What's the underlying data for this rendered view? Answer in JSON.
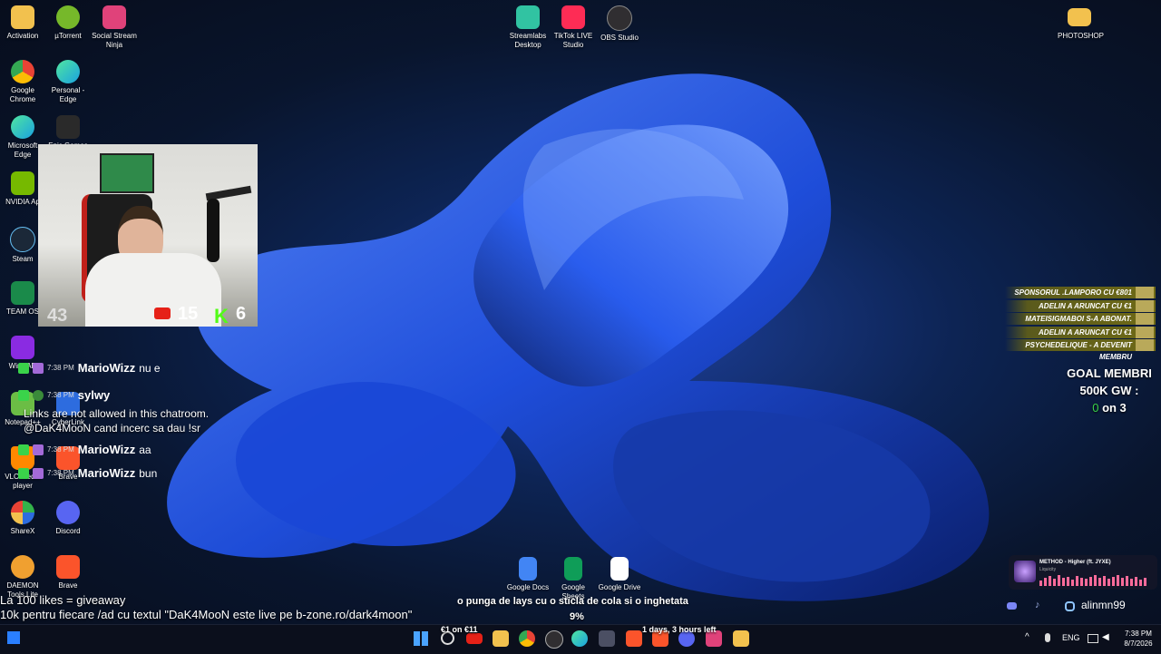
{
  "colors": {
    "accent": "#1f4fe0",
    "chat_badge_green": "#3ad34a",
    "youtube_red": "#e62117",
    "kick_green": "#53fc18",
    "event_gold": "#6f6a16"
  },
  "desktop_icons": [
    {
      "name": "Activation",
      "icon": "folder-icon",
      "color": "#f2c14e"
    },
    {
      "name": "µTorrent",
      "icon": "utorrent-icon",
      "color": "#76b82a"
    },
    {
      "name": "Social Stream Ninja",
      "icon": "social-stream-ninja-icon",
      "color": "#e0427a"
    },
    {
      "name": "Google Chrome",
      "icon": "chrome-icon",
      "color": "#e94335"
    },
    {
      "name": "Personal - Edge",
      "icon": "edge-icon",
      "color": "#1aa2e0"
    },
    {
      "name": "Microsoft Edge",
      "icon": "edge-icon",
      "color": "#1aa2e0"
    },
    {
      "name": "Epic Games",
      "icon": "epic-games-icon",
      "color": "#2a2a2a"
    },
    {
      "name": "NVIDIA Ap",
      "icon": "nvidia-icon",
      "color": "#76b900"
    },
    {
      "name": "Steam",
      "icon": "steam-icon",
      "color": "#1b2838"
    },
    {
      "name": "TEAM OS",
      "icon": "team-os-icon",
      "color": "#1a8a4a"
    },
    {
      "name": "WinRAR",
      "icon": "winrar-icon",
      "color": "#8a2be2"
    },
    {
      "name": "Notepad++",
      "icon": "notepad-plus-plus-icon",
      "color": "#6bbd45"
    },
    {
      "name": "CyberLink",
      "icon": "cyberlink-icon",
      "color": "#2d6cdf"
    },
    {
      "name": "VLC media player",
      "icon": "vlc-icon",
      "color": "#ff8800"
    },
    {
      "name": "Brave",
      "icon": "brave-icon",
      "color": "#fb542b"
    },
    {
      "name": "ShareX",
      "icon": "sharex-icon",
      "color": "#33b34a"
    },
    {
      "name": "Discord",
      "icon": "discord-icon",
      "color": "#5865f2"
    },
    {
      "name": "DAEMON Tools Lite",
      "icon": "daemon-tools-icon",
      "color": "#f0a030"
    },
    {
      "name": "Brave",
      "icon": "brave-icon",
      "color": "#fb542b"
    },
    {
      "name": "Streamlabs Desktop",
      "icon": "streamlabs-icon",
      "color": "#31c3a2"
    },
    {
      "name": "TikTok LIVE Studio",
      "icon": "tiktok-live-icon",
      "color": "#fe2c55"
    },
    {
      "name": "OBS Studio",
      "icon": "obs-icon",
      "color": "#302e31"
    },
    {
      "name": "PHOTOSHOP",
      "icon": "folder-icon",
      "color": "#f2c14e"
    },
    {
      "name": "Google Docs",
      "icon": "google-docs-icon",
      "color": "#4285f4"
    },
    {
      "name": "Google Sheets",
      "icon": "google-sheets-icon",
      "color": "#0f9d58"
    },
    {
      "name": "Google Drive",
      "icon": "google-drive-icon",
      "color": "#ffffff"
    }
  ],
  "webcam": {
    "viewers": "43",
    "youtube_count": "15",
    "kick_count": "6"
  },
  "chat": {
    "messages": [
      {
        "time": "7:38 PM",
        "user": "MarioWizz",
        "text": "nu e"
      },
      {
        "time": "7:38 PM",
        "user": "sylwy",
        "text": ""
      },
      {
        "time": "7:38 PM",
        "user": "MarioWizz",
        "text": "aa"
      },
      {
        "time": "7:38 PM",
        "user": "MarioWizz",
        "text": "bun"
      }
    ],
    "system_line1": "Links are not allowed in this chatroom.",
    "system_line2": "@DaK4MooN cand incerc sa dau !sr"
  },
  "events": [
    "SPONSORUL .LAMPORO CU €801",
    "ADELIN A ARUNCAT CU €1",
    "MATEISIGMABOI S-A ABONAT.",
    "ADELIN A ARUNCAT CU €1",
    "PSYCHEDELIQUE - A DEVENIT MEMBRU"
  ],
  "goal": {
    "line1": "GOAL MEMBRI",
    "line2": "500K GW :",
    "current": "0",
    "rest": "on 3"
  },
  "music": {
    "title": "METHOD - Higher (ft. JYXE)",
    "artist": "Liquicity"
  },
  "social": {
    "handle": "alinmn99"
  },
  "bottom": {
    "line1": "La 100 likes = giveaway",
    "line2": "10k pentru fiecare /ad cu textul \"DaK4MooN este live pe b-zone.ro/dark4moon\""
  },
  "pinned": {
    "message": "o punga de lays cu o sticla de cola si o inghetata",
    "percent": "9%",
    "donation": "€1 on €11",
    "timer": "1 days, 3 hours left"
  },
  "taskbar": {
    "language": "ENG",
    "time": "7:38 PM",
    "date": "8/7/2026"
  }
}
